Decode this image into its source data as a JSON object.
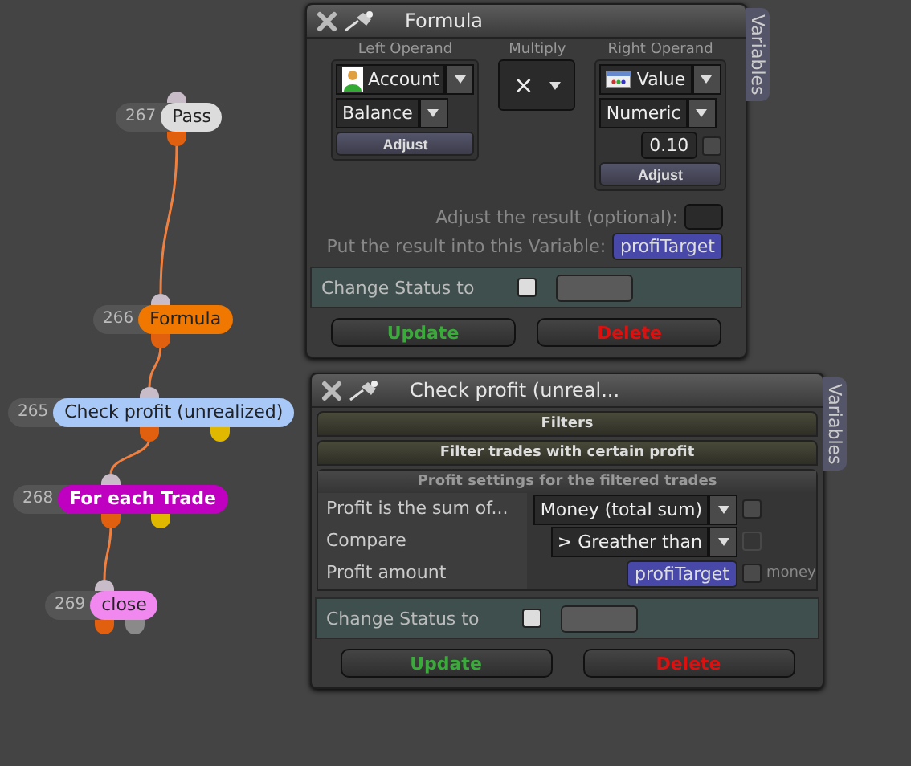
{
  "nodes": [
    {
      "number": "267",
      "label": "Pass",
      "color": "#dcdcdc"
    },
    {
      "number": "266",
      "label": "Formula",
      "color": "#f07800"
    },
    {
      "number": "265",
      "label": "Check profit (unrealized)",
      "color": "#a8c8f8",
      "ports": [
        {
          "color": "#e0b800"
        }
      ]
    },
    {
      "number": "268",
      "label": "For each Trade",
      "color": "#c000c0",
      "ports": [
        {
          "color": "#e0b800"
        }
      ]
    },
    {
      "number": "269",
      "label": "close",
      "color": "#f088f0",
      "ports": [
        {
          "color": "#8a8a8a"
        }
      ]
    }
  ],
  "formula_panel": {
    "title": "Formula",
    "side_tab": "Variables",
    "left_operand": {
      "heading": "Left Operand",
      "source": "Account",
      "field": "Balance",
      "adjust": "Adjust"
    },
    "multiply": {
      "heading": "Multiply",
      "operator": "×"
    },
    "right_operand": {
      "heading": "Right Operand",
      "source": "Value",
      "type": "Numeric",
      "value": "0.10",
      "checked": false,
      "adjust": "Adjust"
    },
    "adjust_result_label": "Adjust the result (optional):",
    "result_label": "Put the result into this Variable:",
    "result_variable": "profiTarget",
    "change_status": {
      "label": "Change Status to",
      "checked": false
    },
    "buttons": [
      {
        "label": "Update",
        "kind": "update"
      },
      {
        "label": "Delete",
        "kind": "delete"
      }
    ]
  },
  "check_panel": {
    "title": "Check profit (unreal...",
    "side_tab": "Variables",
    "sections": [
      "Filters",
      "Filter trades with certain profit"
    ],
    "subheading": "Profit settings for the filtered trades",
    "rows": [
      {
        "label": "Profit is the sum of...",
        "kind": "dropdown",
        "value": "Money (total sum)",
        "checked": false,
        "disabled": false
      },
      {
        "label": "Compare",
        "kind": "dropdown",
        "value": "> Greather than",
        "checked": false,
        "disabled": true
      },
      {
        "label": "Profit amount",
        "kind": "variable",
        "value": "profiTarget",
        "checked": false,
        "disabled": false,
        "note": "money"
      }
    ],
    "change_status": {
      "label": "Change Status to",
      "checked": false
    },
    "buttons": [
      {
        "label": "Update",
        "kind": "update"
      },
      {
        "label": "Delete",
        "kind": "delete"
      }
    ]
  }
}
